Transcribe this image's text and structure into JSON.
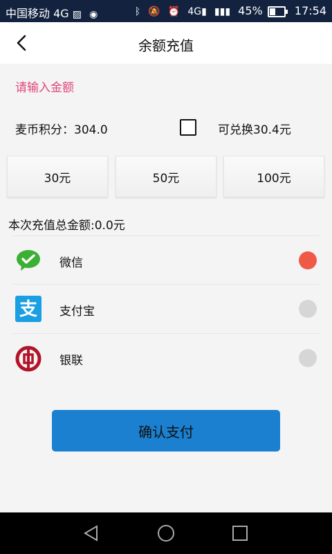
{
  "status": {
    "carrier": "中国移动 4G",
    "battery_percent": "45%",
    "time": "17:54"
  },
  "header": {
    "title": "余额充值"
  },
  "amount_input": {
    "placeholder": "请输入金额"
  },
  "points": {
    "label": "麦币积分：304.0",
    "exchange_label": "可兑换30.4元",
    "checked": false
  },
  "amounts": [
    "30元",
    "50元",
    "100元"
  ],
  "total": "本次充值总金额:0.0元",
  "payment_methods": [
    {
      "label": "微信",
      "icon": "wechat-icon",
      "selected": true
    },
    {
      "label": "支付宝",
      "icon": "alipay-icon",
      "selected": false
    },
    {
      "label": "银联",
      "icon": "unionpay-icon",
      "selected": false
    }
  ],
  "confirm_label": "确认支付",
  "colors": {
    "accent_pink": "#e0467c",
    "radio_selected": "#ee5a46",
    "confirm_button": "#1a80cf",
    "status_bar": "#13233f"
  }
}
